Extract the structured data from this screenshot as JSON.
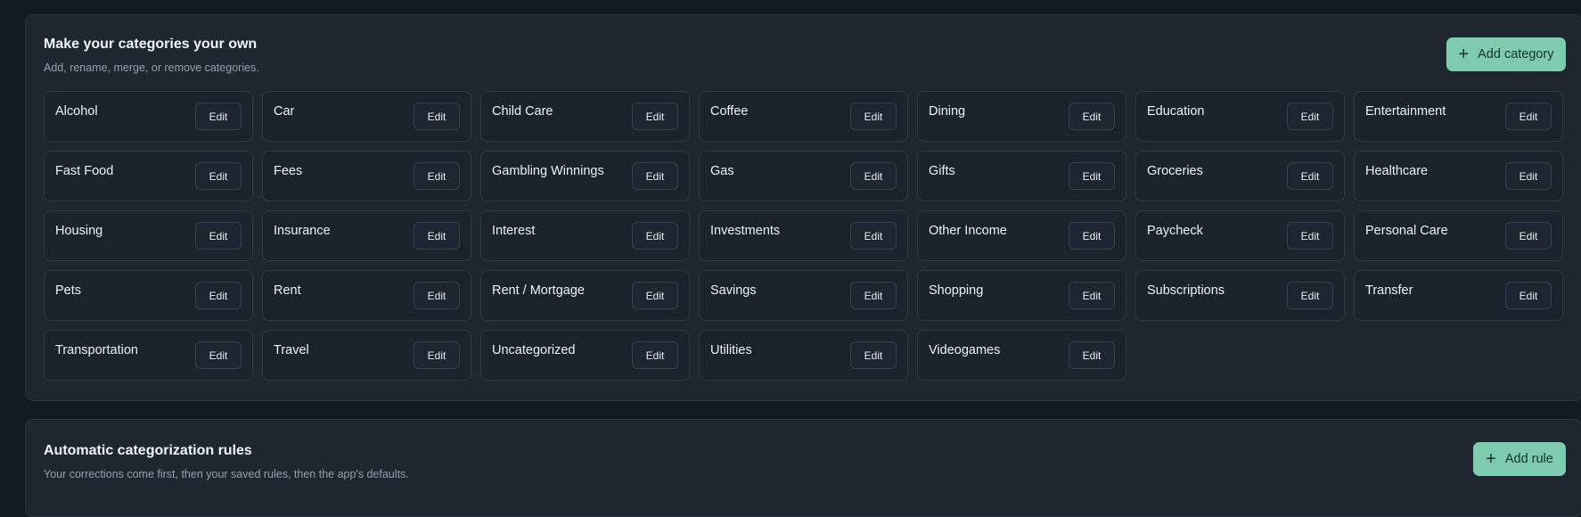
{
  "categories_section": {
    "title": "Make your categories your own",
    "subtitle": "Add, rename, merge, or remove categories.",
    "add_button_label": "Add category",
    "edit_label": "Edit",
    "items": [
      "Alcohol",
      "Car",
      "Child Care",
      "Coffee",
      "Dining",
      "Education",
      "Entertainment",
      "Fast Food",
      "Fees",
      "Gambling Winnings",
      "Gas",
      "Gifts",
      "Groceries",
      "Healthcare",
      "Housing",
      "Insurance",
      "Interest",
      "Investments",
      "Other Income",
      "Paycheck",
      "Personal Care",
      "Pets",
      "Rent",
      "Rent / Mortgage",
      "Savings",
      "Shopping",
      "Subscriptions",
      "Transfer",
      "Transportation",
      "Travel",
      "Uncategorized",
      "Utilities",
      "Videogames"
    ]
  },
  "rules_section": {
    "title": "Automatic categorization rules",
    "subtitle": "Your corrections come first, then your saved rules, then the app's defaults.",
    "add_button_label": "Add rule"
  },
  "colors": {
    "page_background": "#141a21",
    "card_background": "#1e2630",
    "accent": "#7ecbb0"
  },
  "icons": {
    "add": "plus-icon"
  }
}
